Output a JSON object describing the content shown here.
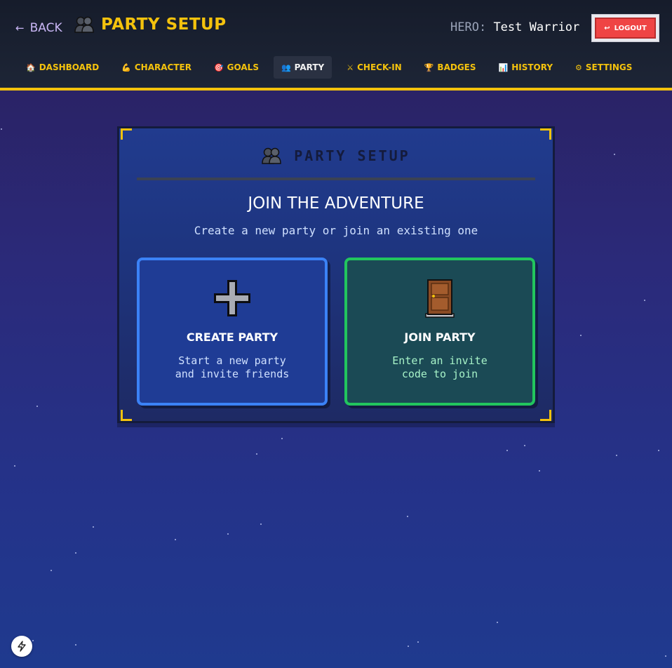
{
  "header": {
    "back_label": "BACK",
    "title": "PARTY SETUP",
    "hero_label": "HERO:",
    "hero_name": "Test Warrior",
    "logout_label": "LOGOUT"
  },
  "nav": [
    {
      "icon": "house-icon",
      "label": "DASHBOARD",
      "active": false
    },
    {
      "icon": "flexed-arm-icon",
      "label": "CHARACTER",
      "active": false
    },
    {
      "icon": "target-icon",
      "label": "GOALS",
      "active": false
    },
    {
      "icon": "people-icon",
      "label": "PARTY",
      "active": true
    },
    {
      "icon": "crossed-swords-icon",
      "label": "CHECK-IN",
      "active": false
    },
    {
      "icon": "trophy-icon",
      "label": "BADGES",
      "active": false
    },
    {
      "icon": "bar-chart-icon",
      "label": "HISTORY",
      "active": false
    },
    {
      "icon": "gear-icon",
      "label": "SETTINGS",
      "active": false
    }
  ],
  "card": {
    "heading": "PARTY SETUP",
    "title": "JOIN THE ADVENTURE",
    "subtitle": "Create a new party or join an existing one",
    "create": {
      "icon": "plus-icon",
      "title": "CREATE PARTY",
      "desc_line1": "Start a new party",
      "desc_line2": "and invite friends"
    },
    "join": {
      "icon": "door-icon",
      "title": "JOIN PARTY",
      "desc_line1": "Enter an invite",
      "desc_line2": "code to join"
    }
  },
  "colors": {
    "accent": "#f4c20d",
    "create_border": "#3b82f6",
    "join_border": "#22c55e",
    "logout": "#ef4444"
  }
}
